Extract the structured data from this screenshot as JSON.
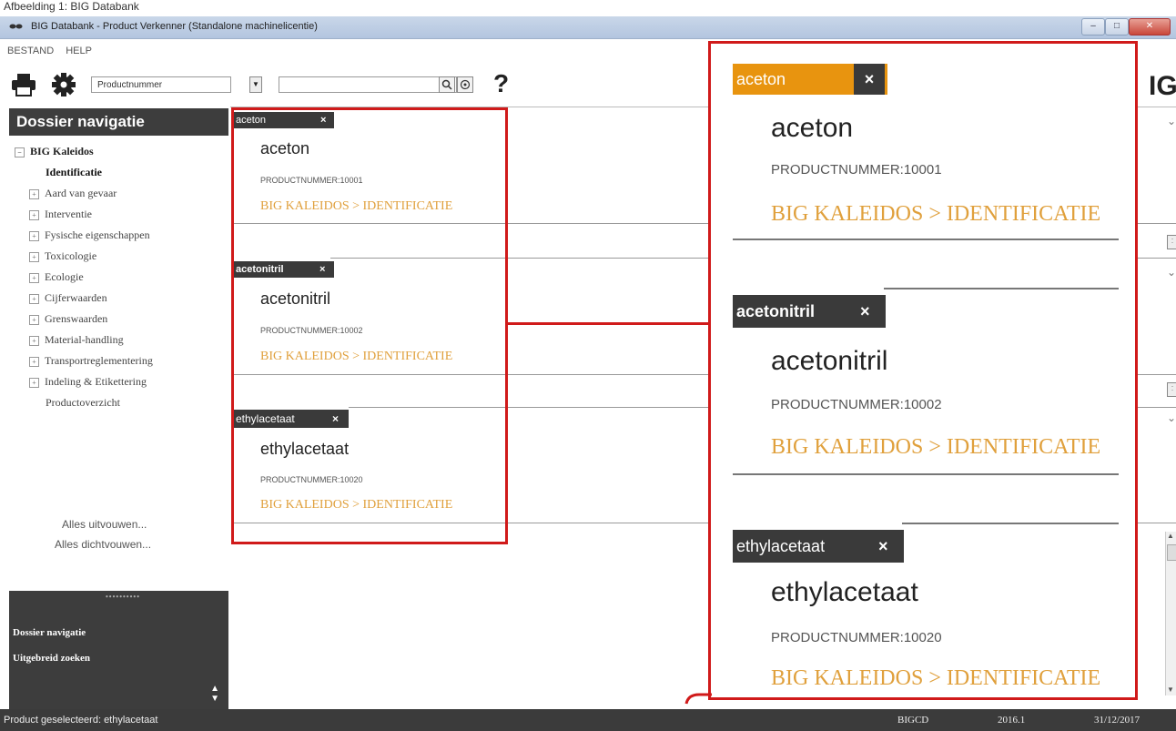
{
  "caption": "Afbeelding 1: BIG Databank",
  "window": {
    "title": "BIG Databank - Product Verkenner (Standalone machinelicentie)",
    "btn_min": "–",
    "btn_max": "□",
    "btn_close": "✕"
  },
  "menu": [
    "BESTAND",
    "HELP"
  ],
  "toolbar": {
    "search_field_value": "Productnummer",
    "search_placeholder": "",
    "help_label": "?",
    "logo_text": "IG"
  },
  "sidebar": {
    "title": "Dossier navigatie",
    "root_label": "BIG Kaleidos",
    "selected_item": "Identificatie",
    "items": [
      "Aard van gevaar",
      "Interventie",
      "Fysische eigenschappen",
      "Toxicologie",
      "Ecologie",
      "Cijferwaarden",
      "Grenswaarden",
      "Material-handling",
      "Transportreglementering",
      "Indeling & Etikettering"
    ],
    "last_item": "Productoverzicht",
    "expand_all": "Alles uitvouwen...",
    "collapse_all": "Alles dichtvouwen...",
    "bottom_nav_1": "Dossier navigatie",
    "bottom_nav_2": "Uitgebreid zoeken"
  },
  "products": [
    {
      "tag": "aceton",
      "name": "aceton",
      "number_label": "PRODUCTNUMMER:",
      "number": "10001",
      "path": "BIG KALEIDOS > IDENTIFICATIE",
      "tag_color": "#e8940f"
    },
    {
      "tag": "acetonitril",
      "name": "acetonitril",
      "number_label": "PRODUCTNUMMER:",
      "number": "10002",
      "path": "BIG KALEIDOS > IDENTIFICATIE",
      "tag_color": "#3a3a3a"
    },
    {
      "tag": "ethylacetaat",
      "name": "ethylacetaat",
      "number_label": "PRODUCTNUMMER:",
      "number": "10020",
      "path": "BIG KALEIDOS > IDENTIFICATIE",
      "tag_color": "#3a3a3a"
    }
  ],
  "status": {
    "selected": "Product geselecteerd: ethylacetaat",
    "db": "BIGCD",
    "version": "2016.1",
    "date": "31/12/2017"
  },
  "colors": {
    "accent": "#e0a03c",
    "highlight": "#d01a1a",
    "dark": "#3d3d3d"
  }
}
